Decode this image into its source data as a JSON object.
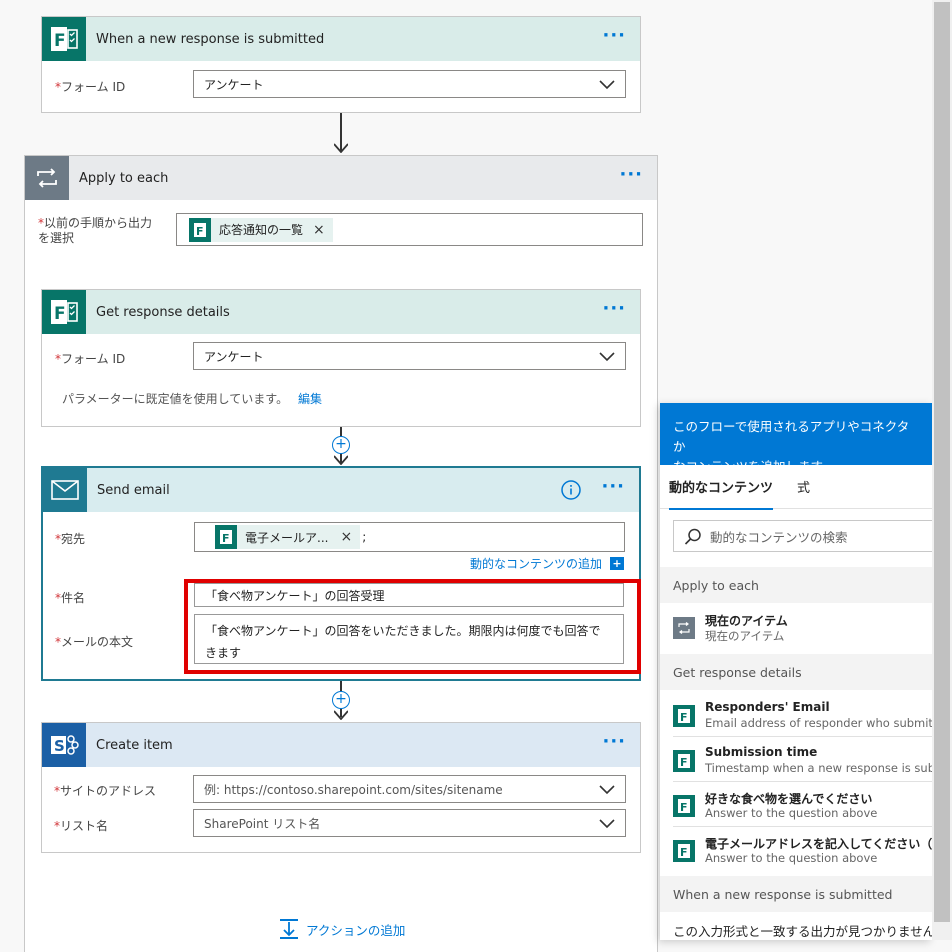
{
  "trigger": {
    "title": "When a new response is submitted",
    "form_id_label": "フォーム ID",
    "form_id_value": "アンケート"
  },
  "apply_each": {
    "title": "Apply to each",
    "select_label_1": "以前の手順から出力",
    "select_label_2": "を選択",
    "token_label": "応答通知の一覧"
  },
  "get_details": {
    "title": "Get response details",
    "form_id_label": "フォーム ID",
    "form_id_value": "アンケート",
    "default_note": "パラメーターに既定値を使用しています。",
    "edit_link": "編集"
  },
  "send_email": {
    "title": "Send email",
    "to_label": "宛先",
    "to_token": "電子メールア...",
    "to_suffix": ";",
    "add_dynamic": "動的なコンテンツの追加",
    "subject_label": "件名",
    "subject_value": "「食べ物アンケート」の回答受理",
    "body_label": "メールの本文",
    "body_line1": "「食べ物アンケート」の回答をいただきました。期限内は何度でも回答で",
    "body_line2": "きます"
  },
  "create_item": {
    "title": "Create item",
    "site_label": "サイトのアドレス",
    "site_placeholder": "例: https://contoso.sharepoint.com/sites/sitename",
    "list_label": "リスト名",
    "list_placeholder": "SharePoint リスト名"
  },
  "add_action": "アクションの追加",
  "dynamic_panel": {
    "header_line1": "このフローで使用されるアプリやコネクタか",
    "header_line2": "なコンテンツを追加します。",
    "tab_dynamic": "動的なコンテンツ",
    "tab_expression": "式",
    "search_placeholder": "動的なコンテンツの検索",
    "sections": {
      "apply_each": "Apply to each",
      "get_details": "Get response details",
      "trigger": "When a new response is submitted"
    },
    "items": [
      {
        "title": "現在のアイテム",
        "sub": "現在のアイテム",
        "icon": "loop-icon"
      },
      {
        "title": "Responders' Email",
        "sub": "Email address of responder who submitted",
        "icon": "forms-icon"
      },
      {
        "title": "Submission time",
        "sub": "Timestamp when a new response is submit",
        "icon": "forms-icon"
      },
      {
        "title": "好きな食べ物を選んでください",
        "sub": "Answer to the question above",
        "icon": "forms-icon"
      },
      {
        "title": "電子メールアドレスを記入してください（",
        "sub": "Answer to the question above",
        "icon": "forms-icon"
      }
    ],
    "footer_note": "この入力形式と一致する出力が見つかりません。"
  },
  "colors": {
    "forms_green": "#077568",
    "forms_header": "#d9ece9",
    "loop_gray": "#6d7a86",
    "loop_header": "#e8eaec",
    "outlook_teal": "#1f7a92",
    "outlook_header": "#d8ecef",
    "sharepoint_blue": "#1b5fa5",
    "sharepoint_header": "#dce8f3",
    "accent_blue": "#0078d4",
    "highlight_red": "#e00000"
  }
}
